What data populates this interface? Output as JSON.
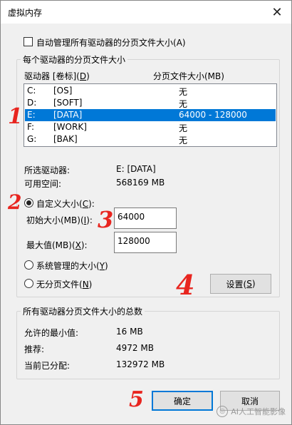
{
  "title": "虚拟内存",
  "auto_manage": {
    "label": "自动管理所有驱动器的分页文件大小",
    "accel": "(A)",
    "checked": false
  },
  "drives_group": {
    "title": "每个驱动器的分页文件大小",
    "col_drive": "驱动器 [卷标](",
    "col_drive_accel": "D",
    "col_drive_end": ")",
    "col_size": "分页文件大小(MB)",
    "rows": [
      {
        "drive": "C:",
        "label": "[OS]",
        "size": "无",
        "selected": false
      },
      {
        "drive": "D:",
        "label": "[SOFT]",
        "size": "无",
        "selected": false
      },
      {
        "drive": "E:",
        "label": "[DATA]",
        "size": "64000 - 128000",
        "selected": true
      },
      {
        "drive": "F:",
        "label": "[WORK]",
        "size": "无",
        "selected": false
      },
      {
        "drive": "G:",
        "label": "[BAK]",
        "size": "无",
        "selected": false
      }
    ],
    "selected_drive_label": "所选驱动器:",
    "selected_drive_value": "E:  [DATA]",
    "free_space_label": "可用空间:",
    "free_space_value": "568169 MB",
    "custom_size": "自定义大小(",
    "custom_size_accel": "C",
    "custom_size_end": "):",
    "initial_label": "初始大小(MB)(",
    "initial_accel": "I",
    "initial_end": "):",
    "initial_value": "64000",
    "max_label": "最大值(MB)(",
    "max_accel": "X",
    "max_end": "):",
    "max_value": "128000",
    "system_managed": "系统管理的大小(",
    "system_managed_accel": "Y",
    "system_managed_end": ")",
    "no_paging": "无分页文件(",
    "no_paging_accel": "N",
    "no_paging_end": ")",
    "set_button": "设置(",
    "set_button_accel": "S",
    "set_button_end": ")",
    "selected_option": "custom"
  },
  "totals_group": {
    "title": "所有驱动器分页文件大小的总数",
    "min_label": "允许的最小值:",
    "min_value": "16 MB",
    "recommended_label": "推荐:",
    "recommended_value": "4972 MB",
    "current_label": "当前已分配:",
    "current_value": "132972 MB"
  },
  "buttons": {
    "ok": "确定",
    "cancel": "取消"
  },
  "annotations": [
    "1",
    "2",
    "3",
    "4",
    "5"
  ],
  "watermark": "AI人工智能影像",
  "colors": {
    "selection": "#0078d7",
    "annotation": "#e8251f"
  }
}
